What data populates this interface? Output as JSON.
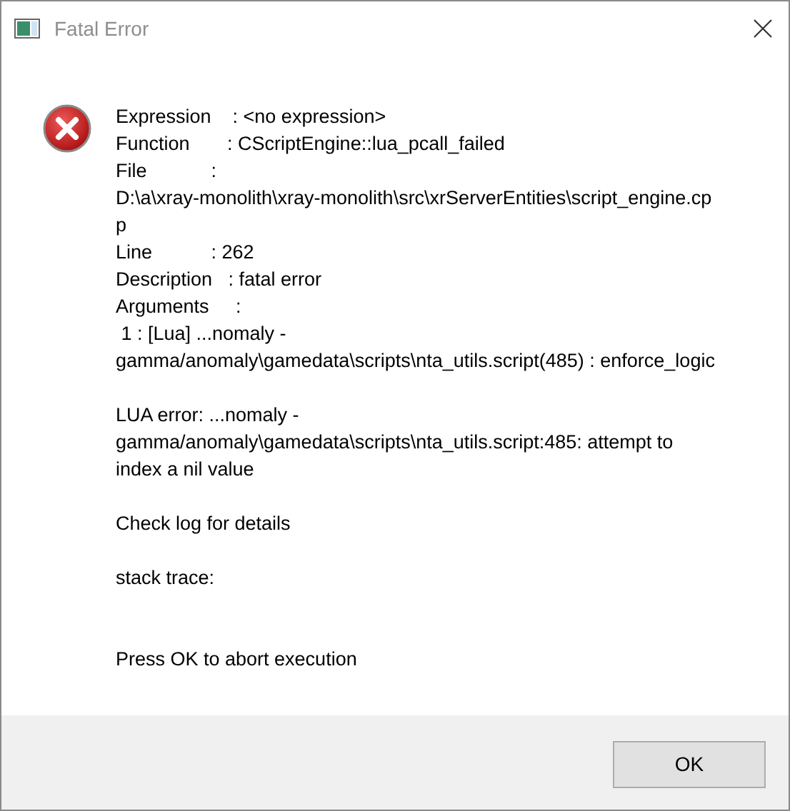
{
  "window": {
    "title": "Fatal Error"
  },
  "message": [
    {
      "lines": [
        "Expression    : <no expression>",
        "Function       : CScriptEngine::lua_pcall_failed",
        "File            :",
        "D:\\a\\xray-monolith\\xray-monolith\\src\\xrServerEntities\\script_engine.cp",
        "p",
        "Line           : 262",
        "Description   : fatal error",
        "Arguments     :",
        " 1 : [Lua] ...nomaly -",
        "gamma/anomaly\\gamedata\\scripts\\nta_utils.script(485) : enforce_logic"
      ]
    },
    {
      "lines": [
        "LUA error: ...nomaly -",
        "gamma/anomaly\\gamedata\\scripts\\nta_utils.script:485: attempt to",
        "index a nil value"
      ]
    },
    {
      "lines": [
        "Check log for details"
      ]
    },
    {
      "lines": [
        "stack trace:"
      ]
    },
    {
      "lines": [
        "Press OK to abort execution"
      ]
    }
  ],
  "buttons": [
    "OK"
  ]
}
